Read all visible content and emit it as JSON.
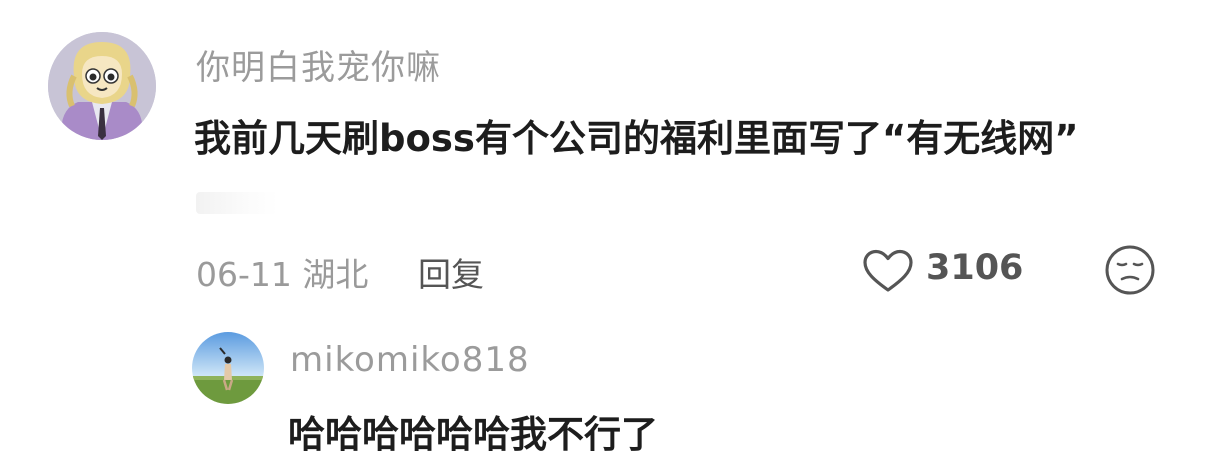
{
  "comment": {
    "username": "你明白我宠你嘛",
    "text": "我前几天刷boss有个公司的福利里面写了“有无线网”",
    "date_location": "06-11 湖北",
    "reply_label": "回复",
    "like_count": "3106",
    "like_icon": "heart-outline-icon",
    "reaction_icon": "meh-face-icon"
  },
  "reply": {
    "username": "mikomiko818",
    "text": "哈哈哈哈哈哈我不行了"
  },
  "colors": {
    "username": "#9b9b9b",
    "text": "#1d1d1d",
    "meta": "#9a9a9a",
    "action": "#555555",
    "background": "#ffffff"
  }
}
